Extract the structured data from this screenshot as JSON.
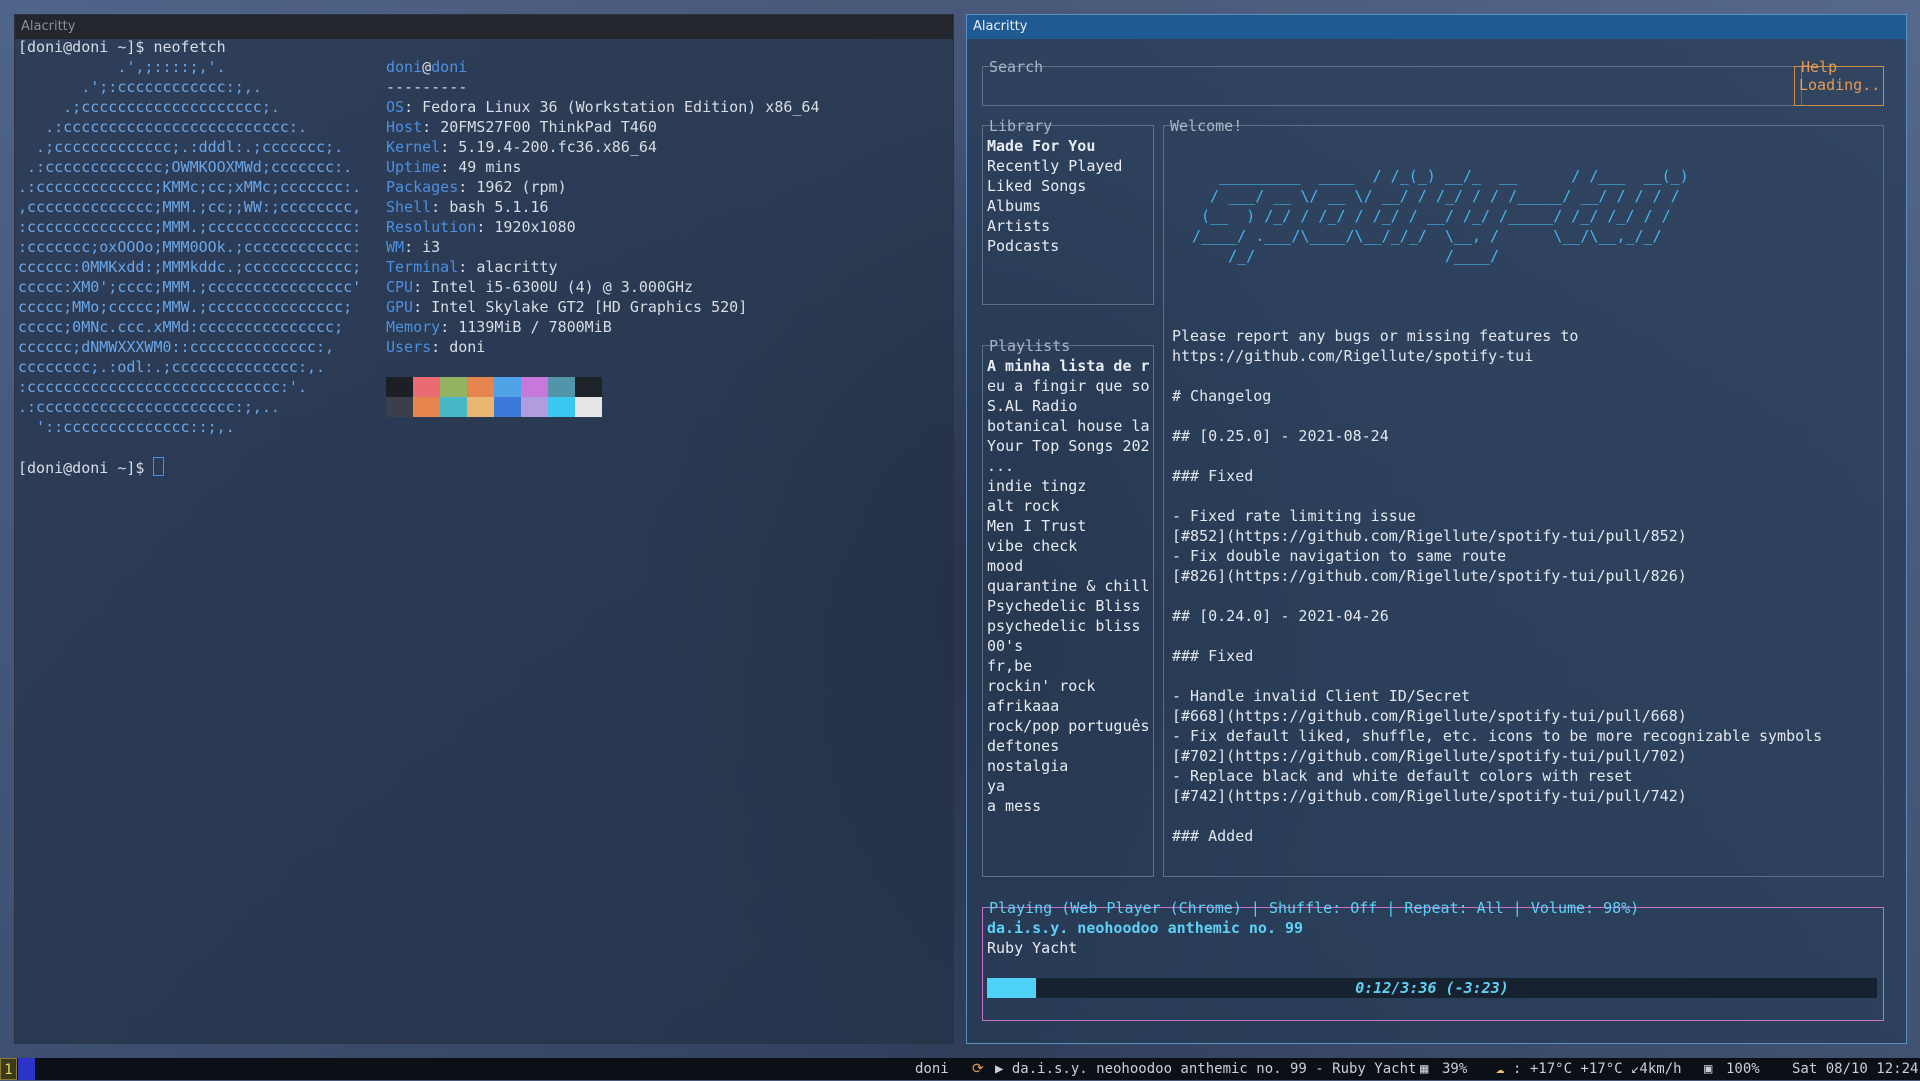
{
  "left_window": {
    "title": "Alacritty",
    "prompt1": "[doni@doni ~]$ neofetch",
    "ascii": [
      "           .',;::::;,'.",
      "       .';:cccccccccccc:;,.",
      "     .;cccccccccccccccccccc;.",
      "   .:ccccccccccccccccccccccccc:.",
      "  .;ccccccccccccc;.:dddl:.;ccccccc;.",
      " .:ccccccccccccc;OWMKOOXMWd;ccccccc:.",
      ".:ccccccccccccc;KMMc;cc;xMMc;ccccccc:.",
      ",cccccccccccccc;MMM.;cc;;WW:;cccccccc,",
      ":cccccccccccccc;MMM.;cccccccccccccccc:",
      ":ccccccc;oxOOOo;MMM0OOk.;cccccccccccc:",
      "cccccc:0MMKxdd:;MMMkddc.;cccccccccccc;",
      "ccccc:XM0';cccc;MMM.;cccccccccccccccc'",
      "ccccc;MMo;ccccc;MMW.;ccccccccccccccc;",
      "ccccc;0MNc.ccc.xMMd:ccccccccccccccc;",
      "cccccc;dNMWXXXWM0::cccccccccccccc:,",
      "cccccccc;.:odl:.;cccccccccccccc:,.",
      ":cccccccccccccccccccccccccccc:'.",
      ".:cccccccccccccccccccccc:;,..",
      "  '::cccccccccccccc::;,."
    ],
    "user": "doni",
    "at": "@",
    "host": "doni",
    "separator": "---------",
    "info": [
      {
        "k": "OS",
        "v": "Fedora Linux 36 (Workstation Edition) x86_64"
      },
      {
        "k": "Host",
        "v": "20FMS27F00 ThinkPad T460"
      },
      {
        "k": "Kernel",
        "v": "5.19.4-200.fc36.x86_64"
      },
      {
        "k": "Uptime",
        "v": "49 mins"
      },
      {
        "k": "Packages",
        "v": "1962 (rpm)"
      },
      {
        "k": "Shell",
        "v": "bash 5.1.16"
      },
      {
        "k": "Resolution",
        "v": "1920x1080"
      },
      {
        "k": "WM",
        "v": "i3"
      },
      {
        "k": "Terminal",
        "v": "alacritty"
      },
      {
        "k": "CPU",
        "v": "Intel i5-6300U (4) @ 3.000GHz"
      },
      {
        "k": "GPU",
        "v": "Intel Skylake GT2 [HD Graphics 520]"
      },
      {
        "k": "Memory",
        "v": "1139MiB / 7800MiB"
      },
      {
        "k": "Users",
        "v": "doni"
      }
    ],
    "palette_top": [
      "#1c1f26",
      "#ea6c73",
      "#91b362",
      "#e5854d",
      "#4fa3e6",
      "#c678dd",
      "#5294a9",
      "#1e2229"
    ],
    "palette_bottom": [
      "#3a3f4b",
      "#e5854d",
      "#47b8c6",
      "#e8b66e",
      "#3d79d8",
      "#b29ce0",
      "#39c8f0",
      "#e6e6e6"
    ],
    "prompt2": "[doni@doni ~]$ "
  },
  "right_window": {
    "title": "Alacritty",
    "search_label": "Search",
    "help_label": "Help",
    "help_text": "Loading..",
    "library_label": "Library",
    "library_items": [
      "Made For You",
      "Recently Played",
      "Liked Songs",
      "Albums",
      "Artists",
      "Podcasts"
    ],
    "playlists_label": "Playlists",
    "playlists": [
      "A minha lista de r",
      "eu a fingir que so",
      "S.AL Radio",
      "botanical house la",
      "Your Top Songs 202",
      "...",
      "indie tingz",
      "alt rock",
      "Men I Trust",
      "vibe check",
      "mood",
      "quarantine & chill",
      "Psychedelic Bliss",
      "psychedelic bliss",
      "00's",
      "fr,be",
      "rockin' rock",
      "afrikaaa",
      "rock/pop português",
      "deftones",
      "nostalgia",
      "ya",
      "a mess"
    ],
    "welcome_label": "Welcome!",
    "logo": [
      "   _________  ____  / /_(_) __/_  __      / /___  __(_)",
      "  / ___/ __ \\/ __ \\/ __/ / /_/ / / /_____/ __/ / / / /",
      " (__  ) /_/ / /_/ / /_/ / __/ /_/ /_____/ /_/ /_/ / /",
      "/____/ .___/\\____/\\__/_/_/  \\__, /      \\__/\\__,_/_/",
      "    /_/                     /____/"
    ],
    "welcome_lines": [
      "Please report any bugs or missing features to",
      "https://github.com/Rigellute/spotify-tui",
      "",
      "# Changelog",
      "",
      "## [0.25.0] - 2021-08-24",
      "",
      "### Fixed",
      "",
      "- Fixed rate limiting issue",
      "[#852](https://github.com/Rigellute/spotify-tui/pull/852)",
      "- Fix double navigation to same route",
      "[#826](https://github.com/Rigellute/spotify-tui/pull/826)",
      "",
      "## [0.24.0] - 2021-04-26",
      "",
      "### Fixed",
      "",
      "- Handle invalid Client ID/Secret",
      "[#668](https://github.com/Rigellute/spotify-tui/pull/668)",
      "- Fix default liked, shuffle, etc. icons to be more recognizable symbols",
      "[#702](https://github.com/Rigellute/spotify-tui/pull/702)",
      "- Replace black and white default colors with reset",
      "[#742](https://github.com/Rigellute/spotify-tui/pull/742)",
      "",
      "### Added"
    ],
    "player_label": "Playing (Web Player (Chrome) | Shuffle: Off | Repeat: All   | Volume: 98%)",
    "track": "da.i.s.y. neohoodoo anthemic no. 99",
    "artist": "Ruby Yacht",
    "progress_text": "0:12/3:36 (-3:23)",
    "progress_fraction": 0.055
  },
  "statusbar": {
    "workspace": "1",
    "user": "doni",
    "media": "▶ da.i.s.y. neohoodoo anthemic no. 99 - Ruby Yacht",
    "cpu": "39%",
    "weather": ": +17°C +17°C ↙4km/h",
    "brightness": "100%",
    "datetime": "Sat 08/10 12:24"
  }
}
